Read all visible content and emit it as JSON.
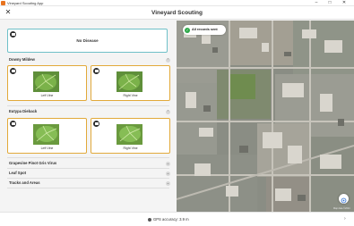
{
  "window": {
    "title": "Vineyard Scouting App"
  },
  "header": {
    "back_icon": "back-arrow-icon",
    "title": "Vineyard Scouting"
  },
  "no_disease": {
    "label": "No Disease"
  },
  "sections": [
    {
      "title": "Downy Mildew",
      "expanded": true,
      "left_label": "Left Vine",
      "right_label": "Right Vine"
    },
    {
      "title": "Eutypa Dieback",
      "expanded": true,
      "left_label": "Left Vine",
      "right_label": "Right Vine"
    },
    {
      "title": "Grapevine Pinot Gris Virus",
      "expanded": false
    },
    {
      "title": "Leaf Spot",
      "expanded": false
    },
    {
      "title": "Tracks and Areas",
      "expanded": false
    }
  ],
  "map": {
    "status": "All records sent",
    "attribution": "Map data ©2024"
  },
  "footer": {
    "gps": "GPS accuracy: 3.9 m"
  },
  "colors": {
    "teal_border": "#6fc0c8",
    "amber_border": "#e2a93a",
    "success": "#2ea84a"
  }
}
